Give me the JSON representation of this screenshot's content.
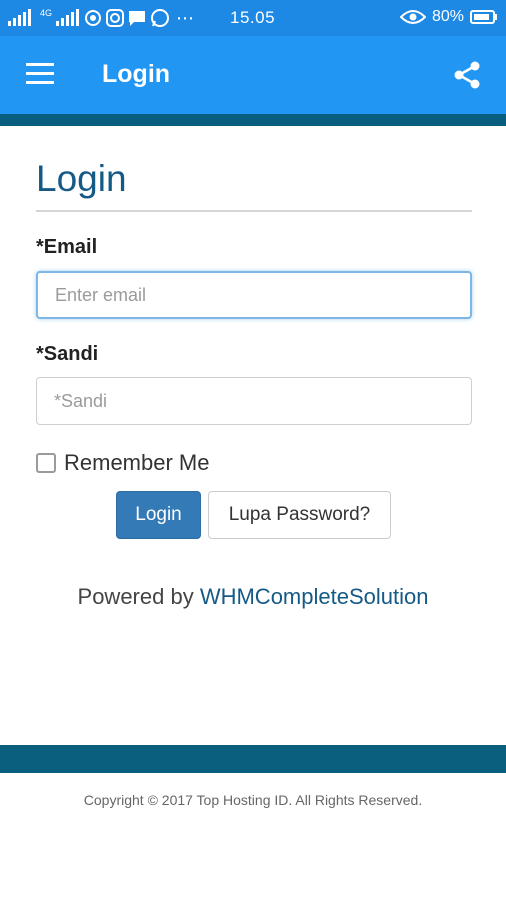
{
  "status_bar": {
    "network": "4G",
    "time": "15.05",
    "battery": "80%",
    "icons": [
      "signal-icon",
      "signal-4g-icon",
      "hotspot-icon",
      "instagram-icon",
      "message-icon",
      "whatsapp-icon",
      "more-dots-icon",
      "eye-icon",
      "battery-icon"
    ]
  },
  "app_bar": {
    "title": "Login",
    "menu_icon": "hamburger-menu-icon",
    "share_icon": "share-icon"
  },
  "login_form": {
    "heading": "Login",
    "email_label": "*Email",
    "email_placeholder": "Enter email",
    "email_value": "",
    "password_label": "*Sandi",
    "password_placeholder": "*Sandi",
    "password_value": "",
    "remember_label": "Remember Me",
    "remember_checked": false,
    "login_button": "Login",
    "forgot_button": "Lupa Password?"
  },
  "powered": {
    "prefix": "Powered by",
    "link": "WHMCompleteSolution"
  },
  "footer": {
    "copyright": "Copyright © 2017 Top Hosting ID. All Rights Reserved."
  },
  "colors": {
    "status_bar": "#1e88e5",
    "app_bar": "#2196f3",
    "stripe": "#0b5f7e",
    "heading": "#155a87",
    "primary_button": "#337ab7"
  }
}
